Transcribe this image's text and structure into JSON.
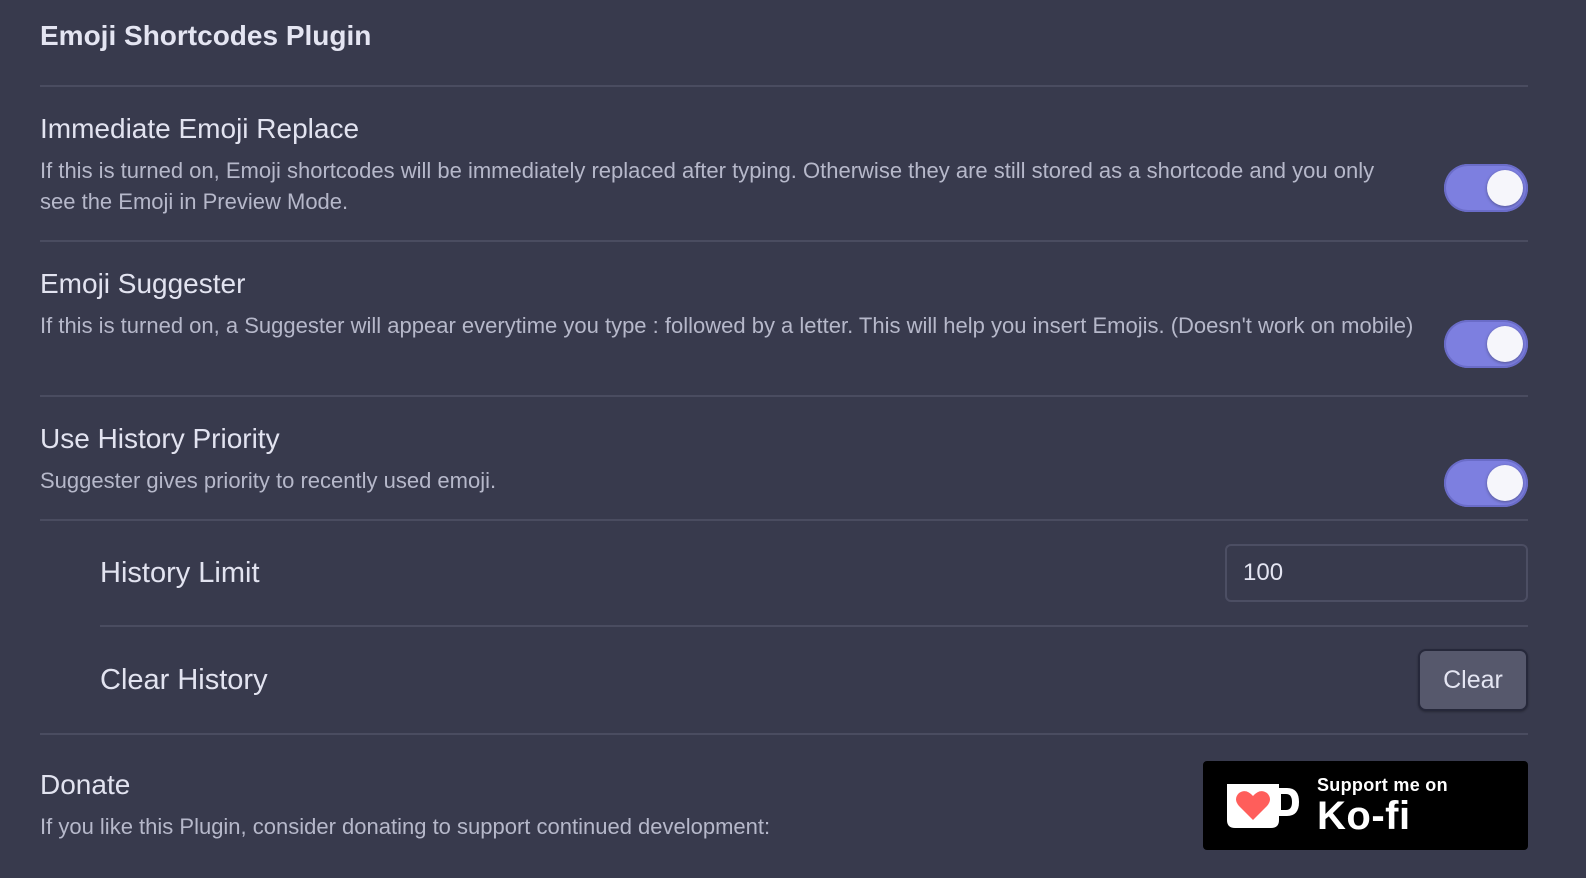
{
  "page": {
    "title": "Emoji Shortcodes Plugin"
  },
  "settings": {
    "immediate_replace": {
      "name": "Immediate Emoji Replace",
      "description": "If this is turned on, Emoji shortcodes will be immediately replaced after typing. Otherwise they are still stored as a shortcode and you only see the Emoji in Preview Mode.",
      "enabled": true
    },
    "suggester": {
      "name": "Emoji Suggester",
      "description": "If this is turned on, a Suggester will appear everytime you type : followed by a letter. This will help you insert Emojis. (Doesn't work on mobile)",
      "enabled": true
    },
    "history_priority": {
      "name": "Use History Priority",
      "description": "Suggester gives priority to recently used emoji.",
      "enabled": true
    },
    "history_limit": {
      "name": "History Limit",
      "value": "100"
    },
    "clear_history": {
      "name": "Clear History",
      "button_label": "Clear"
    },
    "donate": {
      "name": "Donate",
      "description": "If you like this Plugin, consider donating to support continued development:",
      "kofi_small": "Support me on",
      "kofi_big": "Ko-fi"
    }
  },
  "colors": {
    "background": "#383a4d",
    "toggle_on": "#7d7fe0",
    "kofi_heart": "#ff5e5b"
  },
  "icons": {
    "kofi_logo": "kofi-cup-heart-icon"
  }
}
